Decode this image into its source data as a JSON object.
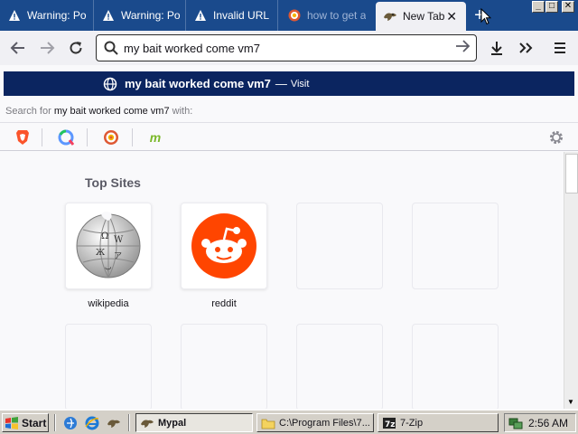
{
  "tabs": [
    {
      "label": "Warning: Po",
      "icon": "warning-icon"
    },
    {
      "label": "Warning: Po",
      "icon": "warning-icon"
    },
    {
      "label": "Invalid URL",
      "icon": "warning-icon"
    },
    {
      "label": "how to get a",
      "icon": "duckduckgo-icon"
    },
    {
      "label": "New Tab",
      "icon": "new-tab-icon"
    }
  ],
  "newtab_button": "+",
  "window_controls": {
    "minimize": "_",
    "maximize": "□",
    "close": "✕"
  },
  "url": {
    "value": "my bait worked come vm7"
  },
  "suggestion": {
    "query": "my bait worked come vm7",
    "dash": "—",
    "action": "Visit"
  },
  "search_with": {
    "prefix": "Search for",
    "query": "my bait worked come vm7",
    "suffix": "with:"
  },
  "engines": [
    "brave-search-icon",
    "qwant-icon",
    "duckduckgo-icon",
    "mojeek-icon"
  ],
  "top_sites": {
    "title": "Top Sites",
    "tiles": [
      {
        "label": "wikipedia",
        "icon": "wikipedia-icon"
      },
      {
        "label": "reddit",
        "icon": "reddit-icon"
      }
    ]
  },
  "taskbar": {
    "start_label": "Start",
    "windows": [
      "Mypal",
      "C:\\Program Files\\7...",
      "7-Zip"
    ],
    "clock": "2:56 AM"
  },
  "colors": {
    "tabstrip": "#1a4a8c",
    "suggest_bg": "#0b2560",
    "reddit": "#ff4500"
  }
}
